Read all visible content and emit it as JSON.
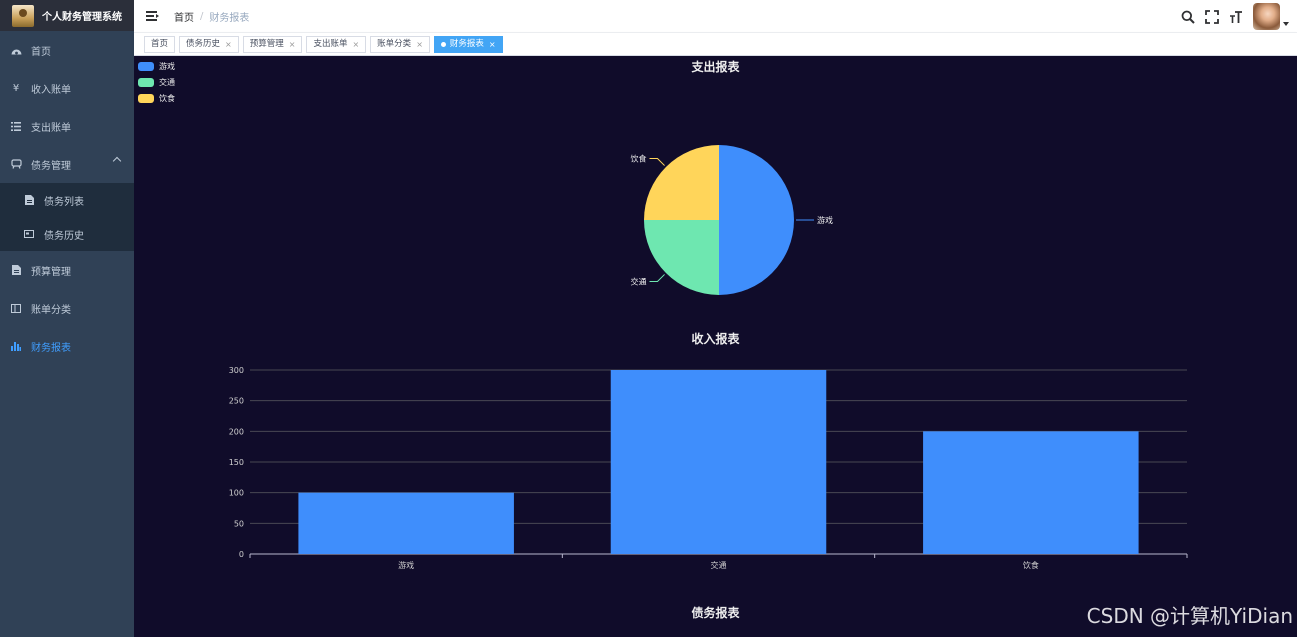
{
  "app": {
    "title": "个人财务管理系统"
  },
  "sidebar": {
    "items": [
      {
        "label": "首页",
        "icon": "dashboard-icon"
      },
      {
        "label": "收入账单",
        "icon": "yen-icon"
      },
      {
        "label": "支出账单",
        "icon": "list-icon"
      },
      {
        "label": "债务管理",
        "icon": "debt-icon",
        "expanded": true,
        "children": [
          {
            "label": "债务列表",
            "icon": "document-icon"
          },
          {
            "label": "债务历史",
            "icon": "card-icon"
          }
        ]
      },
      {
        "label": "预算管理",
        "icon": "budget-icon"
      },
      {
        "label": "账单分类",
        "icon": "category-icon"
      },
      {
        "label": "财务报表",
        "icon": "bar-chart-icon",
        "active": true
      }
    ]
  },
  "navbar": {
    "breadcrumb": [
      "首页",
      "财务报表"
    ]
  },
  "tags": [
    {
      "label": "首页",
      "closable": false
    },
    {
      "label": "债务历史",
      "closable": true
    },
    {
      "label": "预算管理",
      "closable": true
    },
    {
      "label": "支出账单",
      "closable": true
    },
    {
      "label": "账单分类",
      "closable": true
    },
    {
      "label": "财务报表",
      "closable": true,
      "active": true
    }
  ],
  "colors": {
    "accent": "#409eff",
    "background": "#100c2a",
    "sidebar": "#304156"
  },
  "chart_data": [
    {
      "type": "pie",
      "title": "支出报表",
      "categories": [
        "游戏",
        "交通",
        "饮食"
      ],
      "values": [
        2,
        1,
        1
      ],
      "colors": [
        "#3f8efc",
        "#6ee7b0",
        "#ffd55a"
      ],
      "legend": "top-left"
    },
    {
      "type": "bar",
      "title": "收入报表",
      "categories": [
        "游戏",
        "交通",
        "饮食"
      ],
      "values": [
        100,
        300,
        200
      ],
      "ylim": [
        0,
        300
      ],
      "yticks": [
        0,
        50,
        100,
        150,
        200,
        250,
        300
      ],
      "color": "#3f8efc",
      "grid": true
    },
    {
      "type": "bar",
      "title": "债务报表"
    }
  ],
  "watermark": "CSDN @计算机YiDian"
}
